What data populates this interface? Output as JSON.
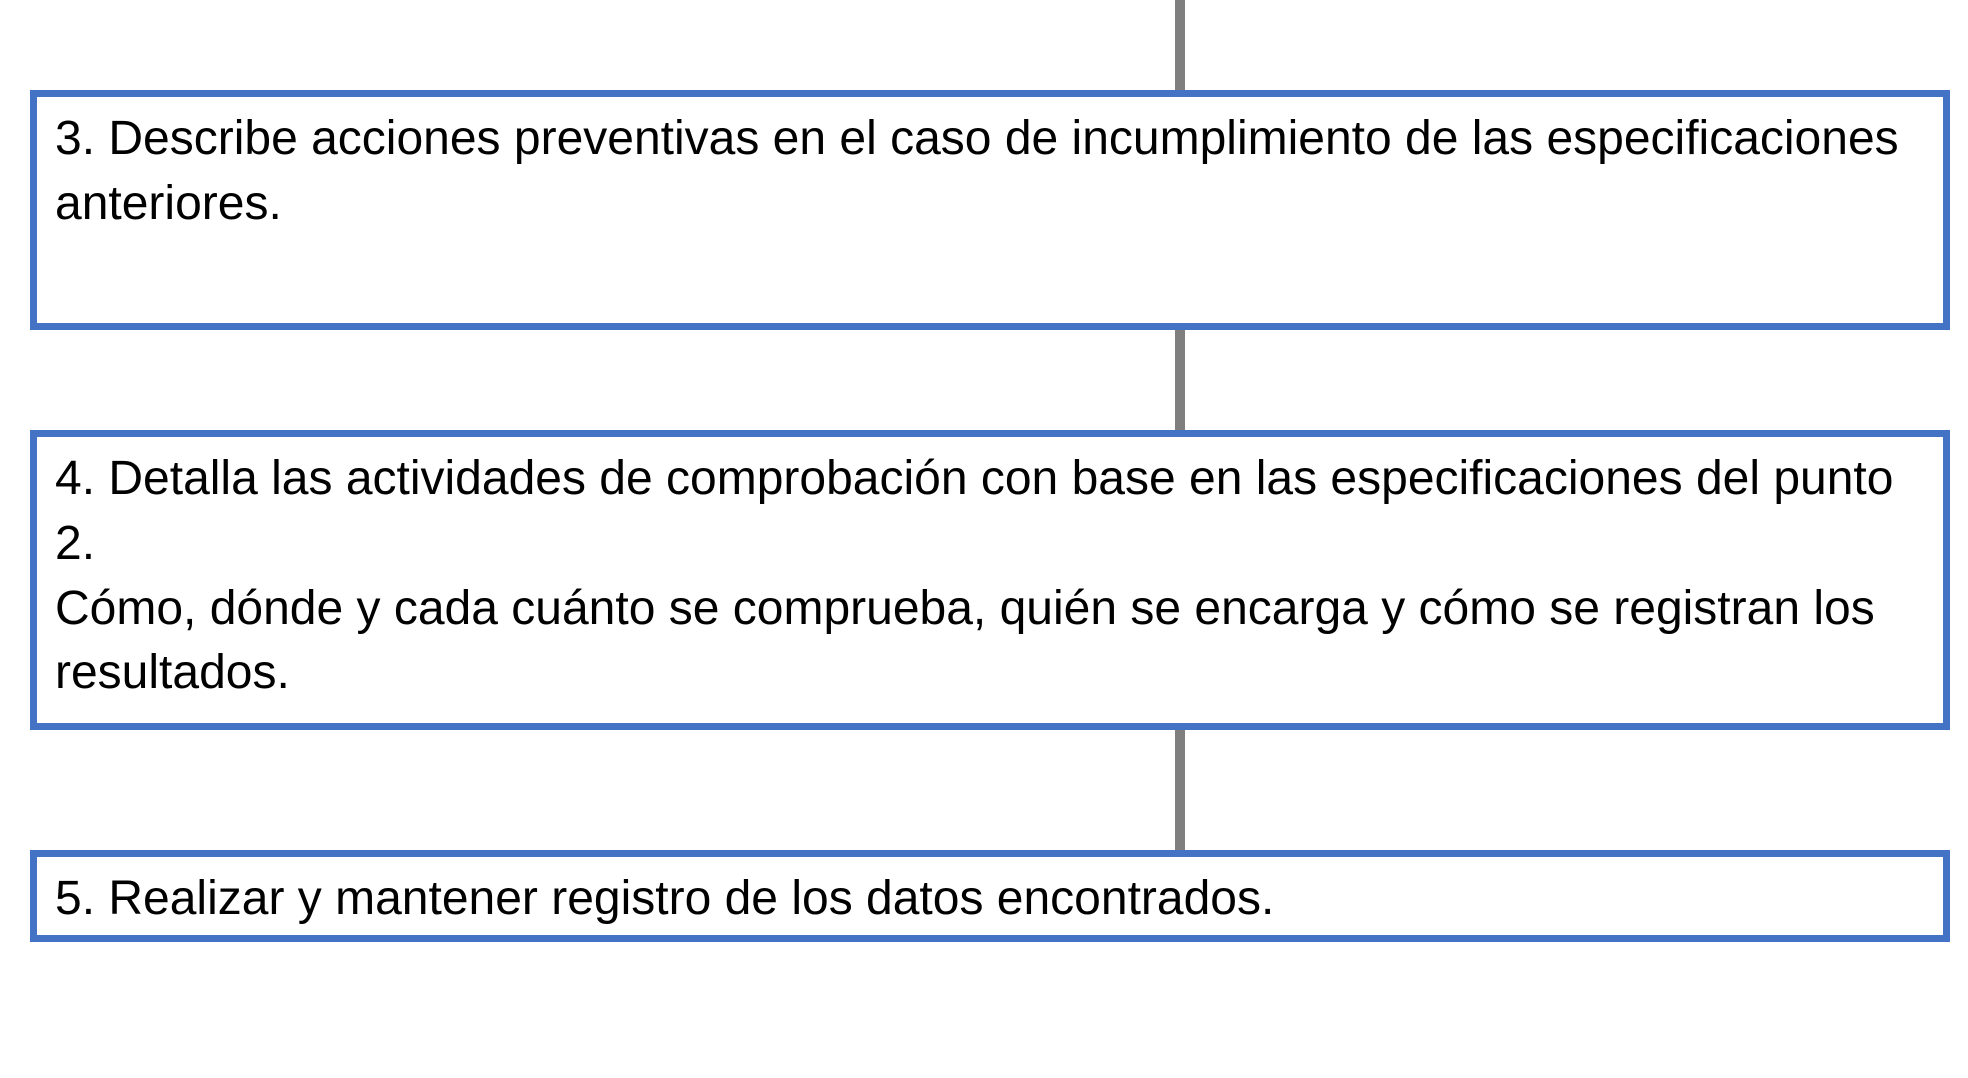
{
  "boxes": {
    "box3": {
      "text": "3. Describe acciones preventivas en el caso de incumplimiento de las especificaciones anteriores."
    },
    "box4": {
      "line1": "4. Detalla las actividades de comprobación con base en las especificaciones del punto 2.",
      "line2": "Cómo, dónde y cada cuánto se comprueba,  quién se encarga y cómo se registran los resultados."
    },
    "box5": {
      "text": "5. Realizar y mantener registro de los datos encontrados."
    }
  },
  "colors": {
    "border": "#4472c4",
    "connector": "#7f7f7f"
  }
}
